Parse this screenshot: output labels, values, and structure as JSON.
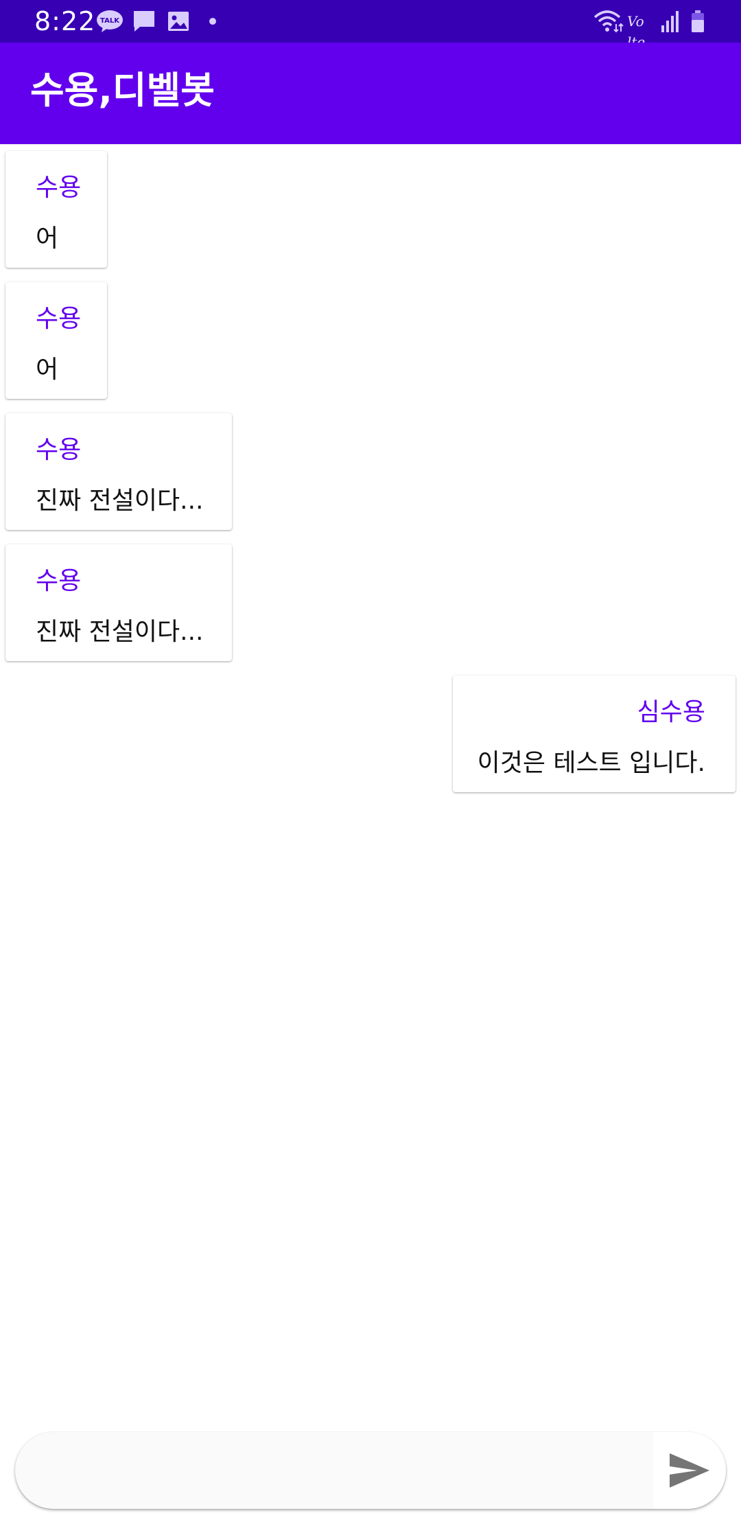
{
  "status_bar": {
    "time": "8:22",
    "icons": [
      "kakaotalk-icon",
      "chat-bubble-icon",
      "image-icon",
      "dot-icon",
      "wifi-icon",
      "volte-icon",
      "signal-icon",
      "battery-icon"
    ],
    "volte_text": "Vo lte"
  },
  "app_bar": {
    "title": "수용,디벨봇",
    "color": "#6200ee"
  },
  "messages": [
    {
      "sender": "수용",
      "text": "어",
      "align": "left"
    },
    {
      "sender": "수용",
      "text": "어",
      "align": "left"
    },
    {
      "sender": "수용",
      "text": "진짜 전설이다...",
      "align": "left"
    },
    {
      "sender": "수용",
      "text": "진짜 전설이다...",
      "align": "left"
    },
    {
      "sender": "심수용",
      "text": "이것은 테스트 입니다.",
      "align": "right"
    }
  ],
  "composer": {
    "input_value": "",
    "placeholder": "",
    "send_icon": "send-icon"
  },
  "colors": {
    "status_bar": "#3700b3",
    "accent": "#6200ee",
    "send_icon": "#757575"
  }
}
